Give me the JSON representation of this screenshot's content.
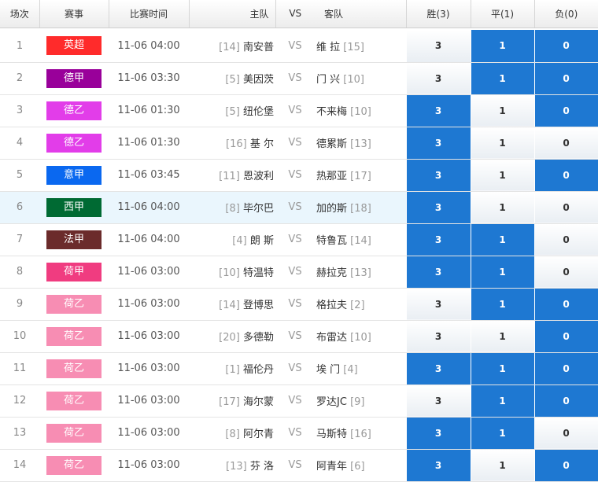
{
  "headers": {
    "index": "场次",
    "league": "赛事",
    "time": "比赛时间",
    "home": "主队",
    "vs": "VS",
    "away": "客队",
    "win": "胜(3)",
    "draw": "平(1)",
    "lose": "负(0)"
  },
  "rows": [
    {
      "index": "1",
      "league": "英超",
      "league_color": "#ff2b2b",
      "time": "11-06 04:00",
      "home_rank": "[14]",
      "home": "南安普",
      "vs": "VS",
      "away": "维 拉",
      "away_rank": "[15]",
      "win": "3",
      "draw": "1",
      "lose": "0",
      "win_sel": false,
      "draw_sel": true,
      "lose_sel": true
    },
    {
      "index": "2",
      "league": "德甲",
      "league_color": "#99009a",
      "time": "11-06 03:30",
      "home_rank": "[5]",
      "home": "美因茨",
      "vs": "VS",
      "away": "门 兴",
      "away_rank": "[10]",
      "win": "3",
      "draw": "1",
      "lose": "0",
      "win_sel": false,
      "draw_sel": true,
      "lose_sel": true
    },
    {
      "index": "3",
      "league": "德乙",
      "league_color": "#e23de9",
      "time": "11-06 01:30",
      "home_rank": "[5]",
      "home": "纽伦堡",
      "vs": "VS",
      "away": "不来梅",
      "away_rank": "[10]",
      "win": "3",
      "draw": "1",
      "lose": "0",
      "win_sel": true,
      "draw_sel": false,
      "lose_sel": true
    },
    {
      "index": "4",
      "league": "德乙",
      "league_color": "#e23de9",
      "time": "11-06 01:30",
      "home_rank": "[16]",
      "home": "基 尔",
      "vs": "VS",
      "away": "德累斯",
      "away_rank": "[13]",
      "win": "3",
      "draw": "1",
      "lose": "0",
      "win_sel": true,
      "draw_sel": false,
      "lose_sel": false
    },
    {
      "index": "5",
      "league": "意甲",
      "league_color": "#0a68f0",
      "time": "11-06 03:45",
      "home_rank": "[11]",
      "home": "恩波利",
      "vs": "VS",
      "away": "热那亚",
      "away_rank": "[17]",
      "win": "3",
      "draw": "1",
      "lose": "0",
      "win_sel": true,
      "draw_sel": false,
      "lose_sel": true
    },
    {
      "index": "6",
      "league": "西甲",
      "league_color": "#006a33",
      "time": "11-06 04:00",
      "home_rank": "[8]",
      "home": "毕尔巴",
      "vs": "VS",
      "away": "加的斯",
      "away_rank": "[18]",
      "win": "3",
      "draw": "1",
      "lose": "0",
      "win_sel": true,
      "draw_sel": false,
      "lose_sel": false
    },
    {
      "index": "7",
      "league": "法甲",
      "league_color": "#6b2b2b",
      "time": "11-06 04:00",
      "home_rank": "[4]",
      "home": "朗 斯",
      "vs": "VS",
      "away": "特鲁瓦",
      "away_rank": "[14]",
      "win": "3",
      "draw": "1",
      "lose": "0",
      "win_sel": true,
      "draw_sel": true,
      "lose_sel": false
    },
    {
      "index": "8",
      "league": "荷甲",
      "league_color": "#f03c80",
      "time": "11-06 03:00",
      "home_rank": "[10]",
      "home": "特温特",
      "vs": "VS",
      "away": "赫拉克",
      "away_rank": "[13]",
      "win": "3",
      "draw": "1",
      "lose": "0",
      "win_sel": true,
      "draw_sel": true,
      "lose_sel": false
    },
    {
      "index": "9",
      "league": "荷乙",
      "league_color": "#f78db3",
      "time": "11-06 03:00",
      "home_rank": "[14]",
      "home": "登博思",
      "vs": "VS",
      "away": "格拉夫",
      "away_rank": "[2]",
      "win": "3",
      "draw": "1",
      "lose": "0",
      "win_sel": false,
      "draw_sel": true,
      "lose_sel": true
    },
    {
      "index": "10",
      "league": "荷乙",
      "league_color": "#f78db3",
      "time": "11-06 03:00",
      "home_rank": "[20]",
      "home": "多德勒",
      "vs": "VS",
      "away": "布雷达",
      "away_rank": "[10]",
      "win": "3",
      "draw": "1",
      "lose": "0",
      "win_sel": false,
      "draw_sel": false,
      "lose_sel": true
    },
    {
      "index": "11",
      "league": "荷乙",
      "league_color": "#f78db3",
      "time": "11-06 03:00",
      "home_rank": "[1]",
      "home": "福伦丹",
      "vs": "VS",
      "away": "埃 门",
      "away_rank": "[4]",
      "win": "3",
      "draw": "1",
      "lose": "0",
      "win_sel": true,
      "draw_sel": true,
      "lose_sel": true
    },
    {
      "index": "12",
      "league": "荷乙",
      "league_color": "#f78db3",
      "time": "11-06 03:00",
      "home_rank": "[17]",
      "home": "海尔蒙",
      "vs": "VS",
      "away": "罗达JC",
      "away_rank": "[9]",
      "win": "3",
      "draw": "1",
      "lose": "0",
      "win_sel": false,
      "draw_sel": true,
      "lose_sel": true
    },
    {
      "index": "13",
      "league": "荷乙",
      "league_color": "#f78db3",
      "time": "11-06 03:00",
      "home_rank": "[8]",
      "home": "阿尔青",
      "vs": "VS",
      "away": "马斯特",
      "away_rank": "[16]",
      "win": "3",
      "draw": "1",
      "lose": "0",
      "win_sel": true,
      "draw_sel": true,
      "lose_sel": false
    },
    {
      "index": "14",
      "league": "荷乙",
      "league_color": "#f78db3",
      "time": "11-06 03:00",
      "home_rank": "[13]",
      "home": "芬 洛",
      "vs": "VS",
      "away": "阿青年",
      "away_rank": "[6]",
      "win": "3",
      "draw": "1",
      "lose": "0",
      "win_sel": true,
      "draw_sel": false,
      "lose_sel": true
    }
  ],
  "colors": {
    "selected": "#1e78d2",
    "highlight_row": "#eaf6fd"
  }
}
